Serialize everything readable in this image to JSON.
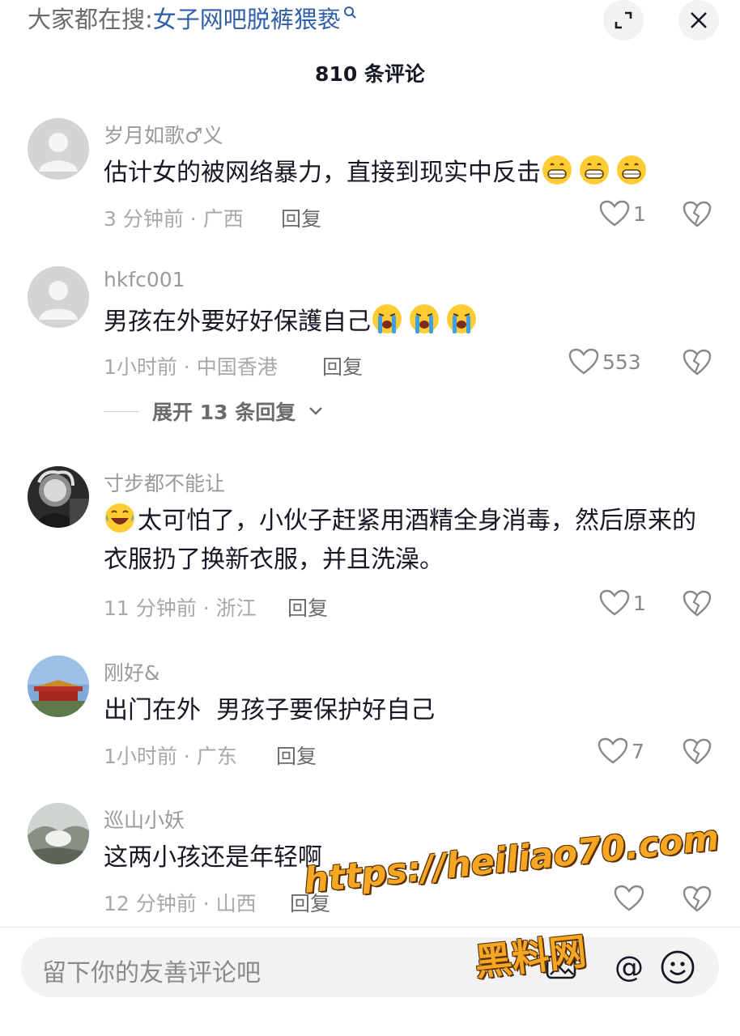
{
  "header": {
    "search_prefix": "大家都在搜:",
    "search_query": "女子网吧脱裤猥亵",
    "search_icon": "search-icon",
    "expand_icon": "expand-icon",
    "close_icon": "close-icon"
  },
  "comment_count": "810 条评论",
  "comments": [
    {
      "username": "岁月如歌♂义",
      "text": "估计女的被网络暴力，直接到现实中反击",
      "emoji": "grin-emoji ×3",
      "meta": "3 分钟前 · 广西",
      "reply_label": "回复",
      "likes": "1"
    },
    {
      "username": "hkfc001",
      "text": "男孩在外要好好保護自己",
      "emoji": "crying-emoji ×3",
      "meta": "1小时前 · 中国香港",
      "reply_label": "回复",
      "likes": "553",
      "expand_label": "展开 13 条回复"
    },
    {
      "username": "寸步都不能让",
      "text": "太可怕了，小伙子赶紧用酒精全身消毒，然后原来的衣服扔了换新衣服，并且洗澡。",
      "emoji": "laugh-cry-emoji",
      "meta": "11 分钟前 · 浙江",
      "reply_label": "回复",
      "likes": "1"
    },
    {
      "username": "刚好&",
      "text": "出门在外  男孩子要保护好自己",
      "meta": "1小时前 · 广东",
      "reply_label": "回复",
      "likes": "7"
    },
    {
      "username": "巡山小妖",
      "text": "这两小孩还是年轻啊",
      "meta": "12 分钟前 · 山西",
      "reply_label": "回复",
      "likes": ""
    }
  ],
  "composer": {
    "placeholder": "留下你的友善评论吧",
    "at_label": "@"
  },
  "watermark": {
    "url": "https://heiliao70.com",
    "name": "黑料网"
  },
  "colors": {
    "query_link": "#2f5fa8",
    "watermark": "#f5a623"
  }
}
